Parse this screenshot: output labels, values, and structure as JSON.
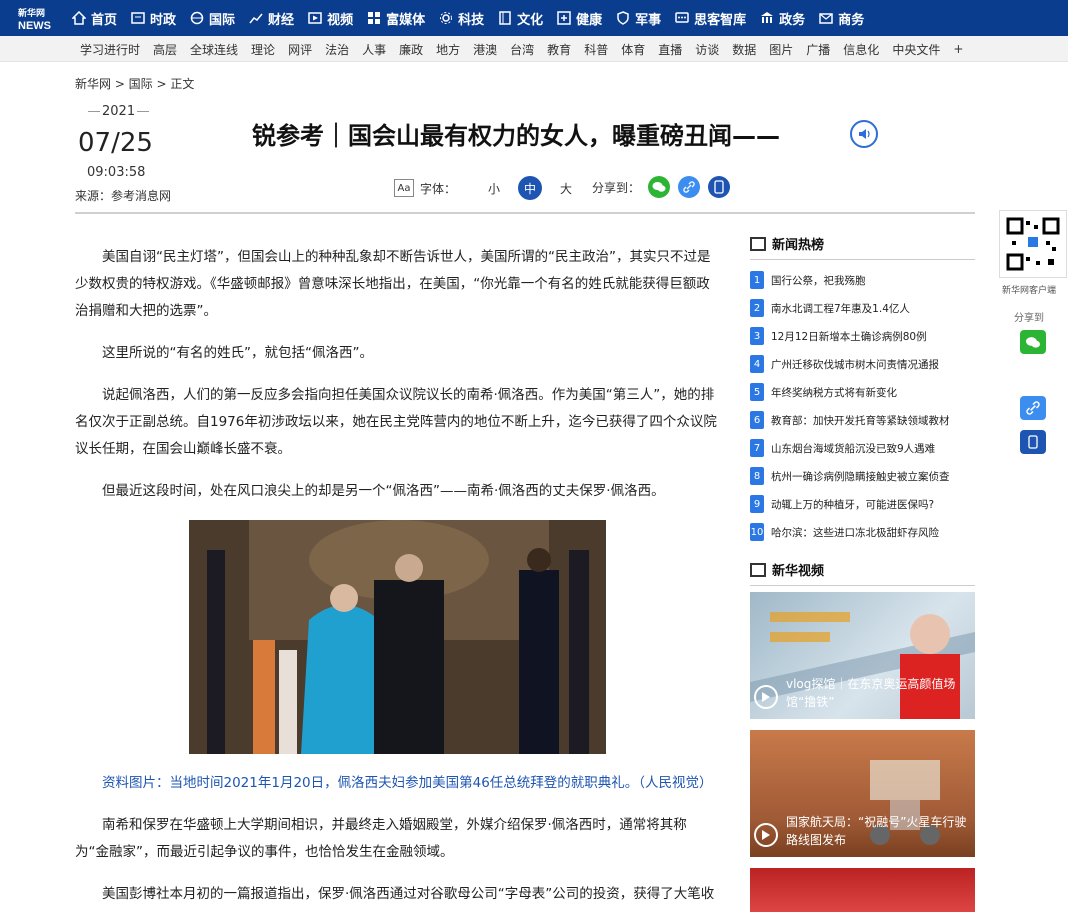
{
  "logo": {
    "text": "NEWS"
  },
  "nav": [
    {
      "label": "首页",
      "icon": "home-icon"
    },
    {
      "label": "时政",
      "icon": "politics-icon"
    },
    {
      "label": "国际",
      "icon": "globe-icon"
    },
    {
      "label": "财经",
      "icon": "chart-icon"
    },
    {
      "label": "视频",
      "icon": "video-icon"
    },
    {
      "label": "富媒体",
      "icon": "media-icon"
    },
    {
      "label": "科技",
      "icon": "gear-icon"
    },
    {
      "label": "文化",
      "icon": "book-icon"
    },
    {
      "label": "健康",
      "icon": "health-icon"
    },
    {
      "label": "军事",
      "icon": "shield-icon"
    },
    {
      "label": "思客智库",
      "icon": "think-icon"
    },
    {
      "label": "政务",
      "icon": "building-icon"
    },
    {
      "label": "商务",
      "icon": "mail-icon"
    }
  ],
  "subnav": [
    "学习进行时",
    "高层",
    "全球连线",
    "理论",
    "网评",
    "法治",
    "人事",
    "廉政",
    "地方",
    "港澳",
    "台湾",
    "教育",
    "科普",
    "体育",
    "直播",
    "访谈",
    "数据",
    "图片",
    "广播",
    "信息化",
    "中央文件",
    "+"
  ],
  "breadcrumb": "新华网 > 国际 > 正文",
  "date": {
    "year": "2021",
    "day": "07/25",
    "time": "09:03:58"
  },
  "source": "来源：参考消息网",
  "title": "锐参考｜国会山最有权力的女人，曝重磅丑闻——",
  "font_control": {
    "label": "字体：",
    "small": "小",
    "medium": "中",
    "large": "大"
  },
  "share_label": "分享到：",
  "article": {
    "p1": "美国自诩“民主灯塔”，但国会山上的种种乱象却不断告诉世人，美国所谓的“民主政治”，其实只不过是少数权贵的特权游戏。《华盛顿邮报》曾意味深长地指出，在美国，“你光靠一个有名的姓氏就能获得巨额政治捐赠和大把的选票”。",
    "p2": "这里所说的“有名的姓氏”，就包括“佩洛西”。",
    "p3": "说起佩洛西，人们的第一反应多会指向担任美国众议院议长的南希·佩洛西。作为美国“第三人”，她的排名仅次于正副总统。自1976年初涉政坛以来，她在民主党阵营内的地位不断上升，迄今已获得了四个众议院议长任期，在国会山巅峰长盛不衰。",
    "p4": "但最近这段时间，处在风口浪尖上的却是另一个“佩洛西”——南希·佩洛西的丈夫保罗·佩洛西。",
    "caption": "资料图片：当地时间2021年1月20日，佩洛西夫妇参加美国第46任总统拜登的就职典礼。（人民视觉）",
    "p5": "南希和保罗在华盛顿上大学期间相识，并最终走入婚姻殿堂，外媒介绍保罗·佩洛西时，通常将其称为“金融家”，而最近引起争议的事件，也恰恰发生在金融领域。",
    "p6": "美国彭博社本月初的一篇报道指出，保罗·佩洛西通过对谷歌母公司“字母表”公司的投资，获得了大笔收"
  },
  "hot_news": {
    "title": "新闻热榜",
    "items": [
      {
        "num": "1",
        "text": "国行公祭，祀我殇胞"
      },
      {
        "num": "2",
        "text": "南水北调工程7年惠及1.4亿人"
      },
      {
        "num": "3",
        "text": "12月12日新增本土确诊病例80例"
      },
      {
        "num": "4",
        "text": "广州迁移砍伐城市树木问责情况通报"
      },
      {
        "num": "5",
        "text": "年终奖纳税方式将有新变化"
      },
      {
        "num": "6",
        "text": "教育部：加快开发托育等紧缺领域教材"
      },
      {
        "num": "7",
        "text": "山东烟台海域货船沉没已致9人遇难"
      },
      {
        "num": "8",
        "text": "杭州一确诊病例隐瞒接触史被立案侦查"
      },
      {
        "num": "9",
        "text": "动辄上万的种植牙，可能进医保吗?"
      },
      {
        "num": "10",
        "text": "哈尔滨：这些进口冻北极甜虾存风险"
      }
    ]
  },
  "video_section": {
    "title": "新华视频",
    "items": [
      {
        "caption": "vlog探馆｜在东京奥运高颜值场馆“撸铁”"
      },
      {
        "caption": "国家航天局：“祝融号”火星车行驶路线图发布"
      }
    ]
  },
  "float": {
    "qr_label": "新华网客户端",
    "share_label": "分享到"
  }
}
